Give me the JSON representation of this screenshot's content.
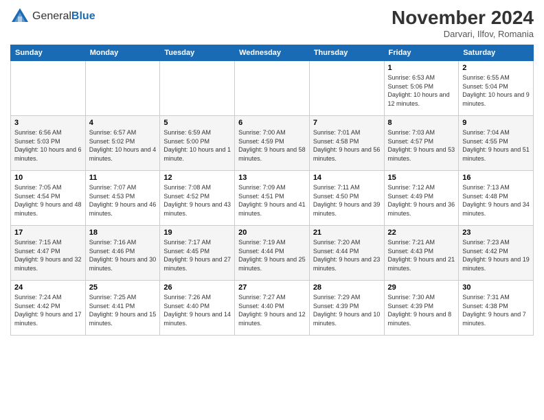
{
  "header": {
    "logo_general": "General",
    "logo_blue": "Blue",
    "month_title": "November 2024",
    "location": "Darvari, Ilfov, Romania"
  },
  "days_of_week": [
    "Sunday",
    "Monday",
    "Tuesday",
    "Wednesday",
    "Thursday",
    "Friday",
    "Saturday"
  ],
  "weeks": [
    {
      "shade": false,
      "days": [
        {
          "num": "",
          "info": ""
        },
        {
          "num": "",
          "info": ""
        },
        {
          "num": "",
          "info": ""
        },
        {
          "num": "",
          "info": ""
        },
        {
          "num": "",
          "info": ""
        },
        {
          "num": "1",
          "info": "Sunrise: 6:53 AM\nSunset: 5:06 PM\nDaylight: 10 hours and 12 minutes."
        },
        {
          "num": "2",
          "info": "Sunrise: 6:55 AM\nSunset: 5:04 PM\nDaylight: 10 hours and 9 minutes."
        }
      ]
    },
    {
      "shade": true,
      "days": [
        {
          "num": "3",
          "info": "Sunrise: 6:56 AM\nSunset: 5:03 PM\nDaylight: 10 hours and 6 minutes."
        },
        {
          "num": "4",
          "info": "Sunrise: 6:57 AM\nSunset: 5:02 PM\nDaylight: 10 hours and 4 minutes."
        },
        {
          "num": "5",
          "info": "Sunrise: 6:59 AM\nSunset: 5:00 PM\nDaylight: 10 hours and 1 minute."
        },
        {
          "num": "6",
          "info": "Sunrise: 7:00 AM\nSunset: 4:59 PM\nDaylight: 9 hours and 58 minutes."
        },
        {
          "num": "7",
          "info": "Sunrise: 7:01 AM\nSunset: 4:58 PM\nDaylight: 9 hours and 56 minutes."
        },
        {
          "num": "8",
          "info": "Sunrise: 7:03 AM\nSunset: 4:57 PM\nDaylight: 9 hours and 53 minutes."
        },
        {
          "num": "9",
          "info": "Sunrise: 7:04 AM\nSunset: 4:55 PM\nDaylight: 9 hours and 51 minutes."
        }
      ]
    },
    {
      "shade": false,
      "days": [
        {
          "num": "10",
          "info": "Sunrise: 7:05 AM\nSunset: 4:54 PM\nDaylight: 9 hours and 48 minutes."
        },
        {
          "num": "11",
          "info": "Sunrise: 7:07 AM\nSunset: 4:53 PM\nDaylight: 9 hours and 46 minutes."
        },
        {
          "num": "12",
          "info": "Sunrise: 7:08 AM\nSunset: 4:52 PM\nDaylight: 9 hours and 43 minutes."
        },
        {
          "num": "13",
          "info": "Sunrise: 7:09 AM\nSunset: 4:51 PM\nDaylight: 9 hours and 41 minutes."
        },
        {
          "num": "14",
          "info": "Sunrise: 7:11 AM\nSunset: 4:50 PM\nDaylight: 9 hours and 39 minutes."
        },
        {
          "num": "15",
          "info": "Sunrise: 7:12 AM\nSunset: 4:49 PM\nDaylight: 9 hours and 36 minutes."
        },
        {
          "num": "16",
          "info": "Sunrise: 7:13 AM\nSunset: 4:48 PM\nDaylight: 9 hours and 34 minutes."
        }
      ]
    },
    {
      "shade": true,
      "days": [
        {
          "num": "17",
          "info": "Sunrise: 7:15 AM\nSunset: 4:47 PM\nDaylight: 9 hours and 32 minutes."
        },
        {
          "num": "18",
          "info": "Sunrise: 7:16 AM\nSunset: 4:46 PM\nDaylight: 9 hours and 30 minutes."
        },
        {
          "num": "19",
          "info": "Sunrise: 7:17 AM\nSunset: 4:45 PM\nDaylight: 9 hours and 27 minutes."
        },
        {
          "num": "20",
          "info": "Sunrise: 7:19 AM\nSunset: 4:44 PM\nDaylight: 9 hours and 25 minutes."
        },
        {
          "num": "21",
          "info": "Sunrise: 7:20 AM\nSunset: 4:44 PM\nDaylight: 9 hours and 23 minutes."
        },
        {
          "num": "22",
          "info": "Sunrise: 7:21 AM\nSunset: 4:43 PM\nDaylight: 9 hours and 21 minutes."
        },
        {
          "num": "23",
          "info": "Sunrise: 7:23 AM\nSunset: 4:42 PM\nDaylight: 9 hours and 19 minutes."
        }
      ]
    },
    {
      "shade": false,
      "days": [
        {
          "num": "24",
          "info": "Sunrise: 7:24 AM\nSunset: 4:42 PM\nDaylight: 9 hours and 17 minutes."
        },
        {
          "num": "25",
          "info": "Sunrise: 7:25 AM\nSunset: 4:41 PM\nDaylight: 9 hours and 15 minutes."
        },
        {
          "num": "26",
          "info": "Sunrise: 7:26 AM\nSunset: 4:40 PM\nDaylight: 9 hours and 14 minutes."
        },
        {
          "num": "27",
          "info": "Sunrise: 7:27 AM\nSunset: 4:40 PM\nDaylight: 9 hours and 12 minutes."
        },
        {
          "num": "28",
          "info": "Sunrise: 7:29 AM\nSunset: 4:39 PM\nDaylight: 9 hours and 10 minutes."
        },
        {
          "num": "29",
          "info": "Sunrise: 7:30 AM\nSunset: 4:39 PM\nDaylight: 9 hours and 8 minutes."
        },
        {
          "num": "30",
          "info": "Sunrise: 7:31 AM\nSunset: 4:38 PM\nDaylight: 9 hours and 7 minutes."
        }
      ]
    }
  ]
}
